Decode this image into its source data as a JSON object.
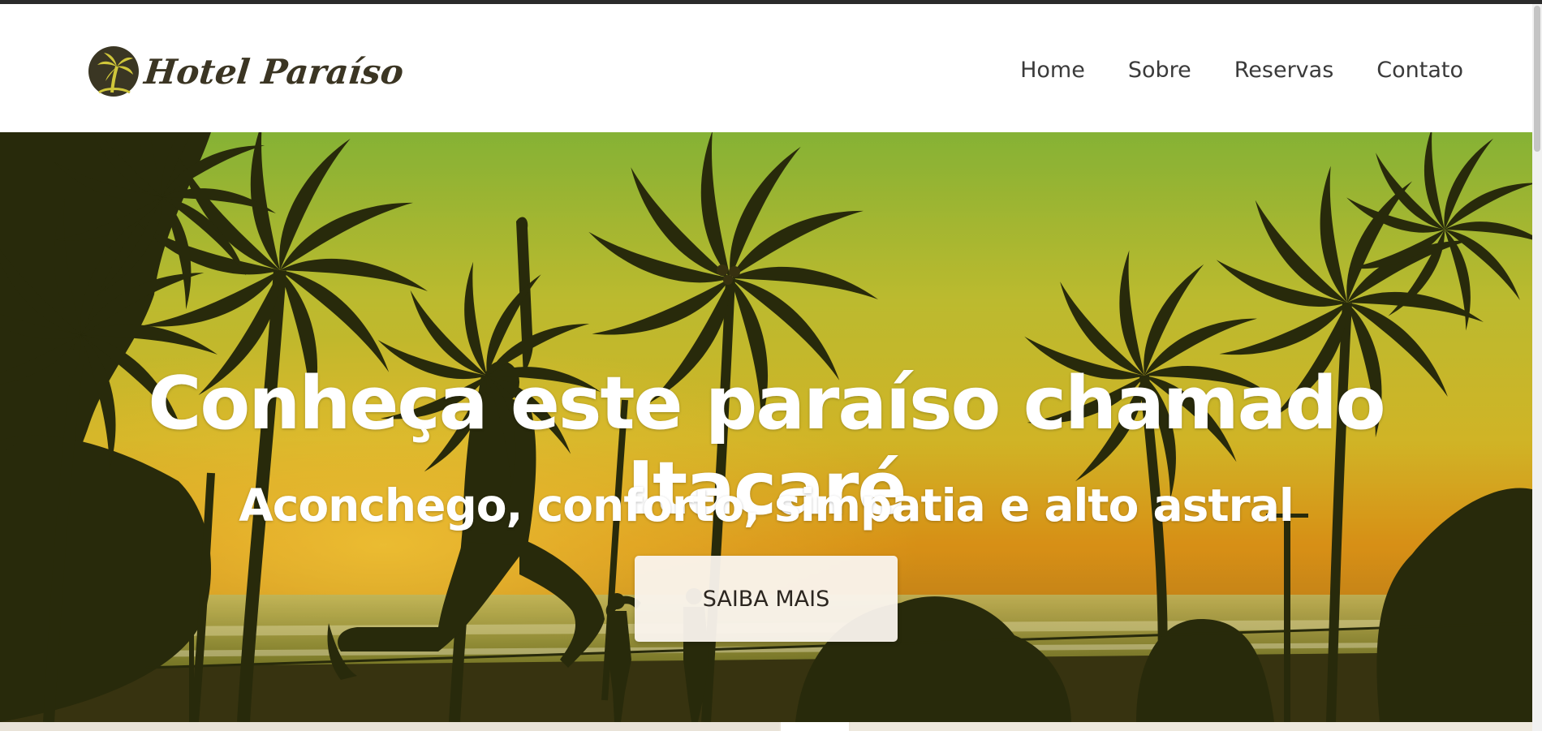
{
  "brand": {
    "name": "Hotel Paraíso",
    "logo_icon": "palm-tree-logo-icon"
  },
  "nav": {
    "items": [
      {
        "label": "Home"
      },
      {
        "label": "Sobre"
      },
      {
        "label": "Reservas"
      },
      {
        "label": "Contato"
      }
    ]
  },
  "hero": {
    "title": "Conheça este paraíso chamado Itacaré",
    "subtitle": "Aconchego, conforto, simpatia e alto astral",
    "cta_label": "SAIBA MAIS",
    "background_icon": "beach-sunset-palm-trees-slackline"
  },
  "colors": {
    "logo_badge": "#3a3623",
    "logo_palm": "#cfc63a",
    "sky_top": "#8fbf3a",
    "sky_mid": "#e0c22a",
    "sunset": "#e89a18",
    "silhouette": "#2a2c0c",
    "cta_background": "#faf4ee",
    "cta_text": "#2c2620"
  }
}
